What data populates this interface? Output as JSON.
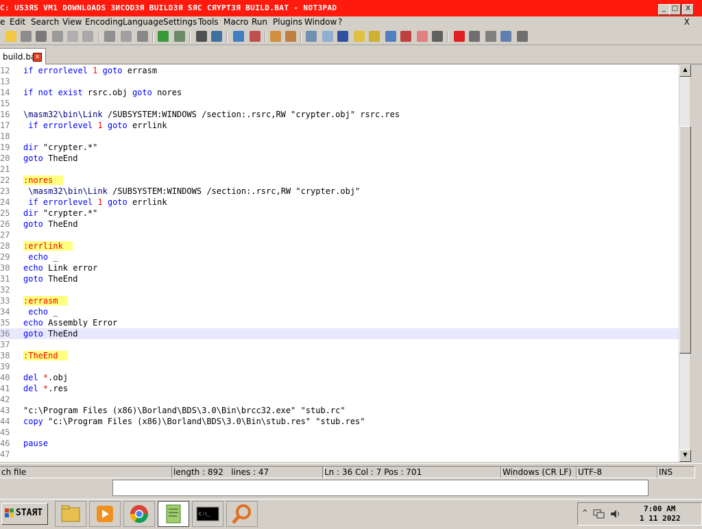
{
  "window": {
    "title": "C: USЗЯS VM1 DOWNLOADS ЗИCODЗЯ BUILDЗЯ SЯC CЯYPTЗЯ BUILD.BAT - NOTЗPAD",
    "min_label": "_",
    "max_label": "□",
    "close_label": "X"
  },
  "menu": {
    "items": [
      "e",
      "Edit",
      "Search",
      "View",
      "Encoding",
      "Language",
      "Settings",
      "Tools",
      "Macro",
      "Run",
      "Plugins",
      "Window",
      "?"
    ],
    "close": "X"
  },
  "tab": {
    "label": "build.bat",
    "close": "x"
  },
  "editor": {
    "lines": [
      {
        "n": "12",
        "code": "if errorlevel 1 goto errasm"
      },
      {
        "n": "13",
        "code": ""
      },
      {
        "n": "14",
        "code": "if not exist rsrc.obj goto nores"
      },
      {
        "n": "15",
        "code": ""
      },
      {
        "n": "16",
        "code": "\\masm32\\bin\\Link /SUBSYSTEM:WINDOWS /section:.rsrc,RW \"crypter.obj\" rsrc.res"
      },
      {
        "n": "17",
        "code": " if errorlevel 1 goto errlink"
      },
      {
        "n": "18",
        "code": ""
      },
      {
        "n": "19",
        "code": "dir \"crypter.*\""
      },
      {
        "n": "20",
        "code": "goto TheEnd"
      },
      {
        "n": "21",
        "code": ""
      },
      {
        "n": "22",
        "code": ":nores"
      },
      {
        "n": "23",
        "code": " \\masm32\\bin\\Link /SUBSYSTEM:WINDOWS /section:.rsrc,RW \"crypter.obj\""
      },
      {
        "n": "24",
        "code": " if errorlevel 1 goto errlink"
      },
      {
        "n": "25",
        "code": "dir \"crypter.*\""
      },
      {
        "n": "26",
        "code": "goto TheEnd"
      },
      {
        "n": "27",
        "code": ""
      },
      {
        "n": "28",
        "code": ":errlink"
      },
      {
        "n": "29",
        "code": " echo _"
      },
      {
        "n": "30",
        "code": "echo Link error"
      },
      {
        "n": "31",
        "code": "goto TheEnd"
      },
      {
        "n": "32",
        "code": ""
      },
      {
        "n": "33",
        "code": ":errasm"
      },
      {
        "n": "34",
        "code": " echo _"
      },
      {
        "n": "35",
        "code": "echo Assembly Error"
      },
      {
        "n": "36",
        "code": "goto TheEnd"
      },
      {
        "n": "37",
        "code": ""
      },
      {
        "n": "38",
        "code": ":TheEnd"
      },
      {
        "n": "39",
        "code": ""
      },
      {
        "n": "40",
        "code": "del *.obj"
      },
      {
        "n": "41",
        "code": "del *.res"
      },
      {
        "n": "42",
        "code": ""
      },
      {
        "n": "43",
        "code": "\"c:\\Program Files (x86)\\Borland\\BDS\\3.0\\Bin\\brcc32.exe\" \"stub.rc\""
      },
      {
        "n": "44",
        "code": "copy \"c:\\Program Files (x86)\\Borland\\BDS\\3.0\\Bin\\stub.res\" \"stub.res\""
      },
      {
        "n": "45",
        "code": ""
      },
      {
        "n": "46",
        "code": "pause"
      },
      {
        "n": "47",
        "code": ""
      }
    ],
    "current_line": "36"
  },
  "status": {
    "filetype": "ch file",
    "length": "length : 892",
    "lines": "lines : 47",
    "pos": "Ln : 36    Col : 7    Pos : 701",
    "eol": "Windows (CR LF)",
    "encoding": "UTF-8",
    "mode": "INS"
  },
  "taskbar": {
    "start_label": "STAЯT",
    "clock_time": "7:00 AM",
    "clock_date": "1 11 2022"
  },
  "colors": {
    "titlebar": "#ff1a0e",
    "keyword": "#0000ff",
    "number": "#ff0000",
    "label_bg": "#ffff80",
    "current_line": "#e8e8ff"
  }
}
